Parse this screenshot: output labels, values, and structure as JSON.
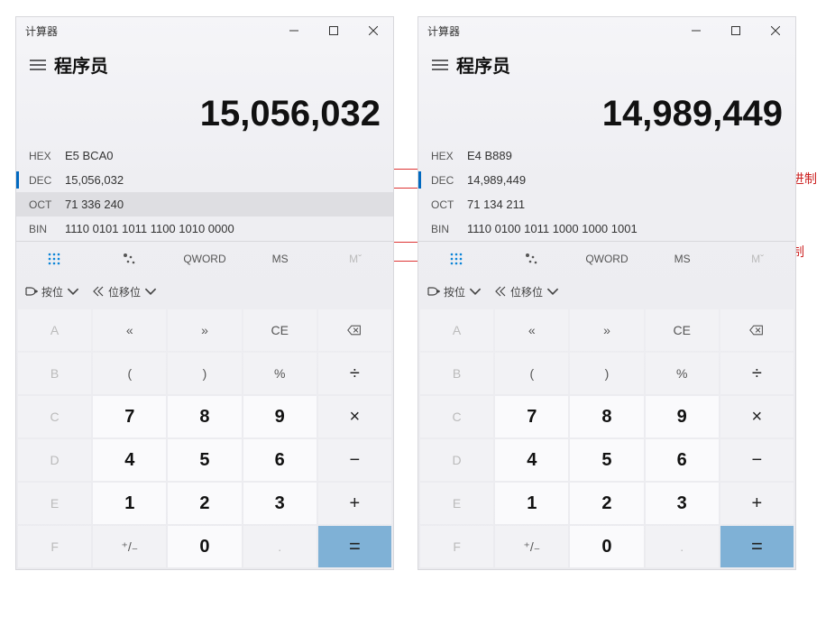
{
  "annotations": {
    "hex": "十六进制",
    "bin": "二进制"
  },
  "window_title": "计算器",
  "mode_name": "程序员",
  "tool": {
    "qword": "QWORD",
    "ms": "MS",
    "mr": "Mˇ"
  },
  "bitops": {
    "byBit": "按位",
    "shift": "位移位"
  },
  "keys": {
    "A": "A",
    "B": "B",
    "C": "C",
    "D": "D",
    "E": "E",
    "F": "F",
    "lsh": "«",
    "rsh": "»",
    "CE": "CE",
    "lp": "(",
    "rp": ")",
    "pct": "%",
    "div": "÷",
    "mul": "×",
    "sub": "−",
    "add": "+",
    "eq": "=",
    "pm": "⁺/₋",
    "dot": ".",
    "0": "0",
    "1": "1",
    "2": "2",
    "3": "3",
    "4": "4",
    "5": "5",
    "6": "6",
    "7": "7",
    "8": "8",
    "9": "9"
  },
  "calcs": [
    {
      "result": "15,056,032",
      "bases": {
        "HEX": "E5 BCA0",
        "DEC": "15,056,032",
        "OCT": "71 336 240",
        "BIN": "1110 0101 1011 1100 1010 0000"
      },
      "selected": "DEC",
      "hover": "OCT"
    },
    {
      "result": "14,989,449",
      "bases": {
        "HEX": "E4 B889",
        "DEC": "14,989,449",
        "OCT": "71 134 211",
        "BIN": "1110 0100 1011 1000 1000 1001"
      },
      "selected": "DEC",
      "hover": ""
    }
  ]
}
